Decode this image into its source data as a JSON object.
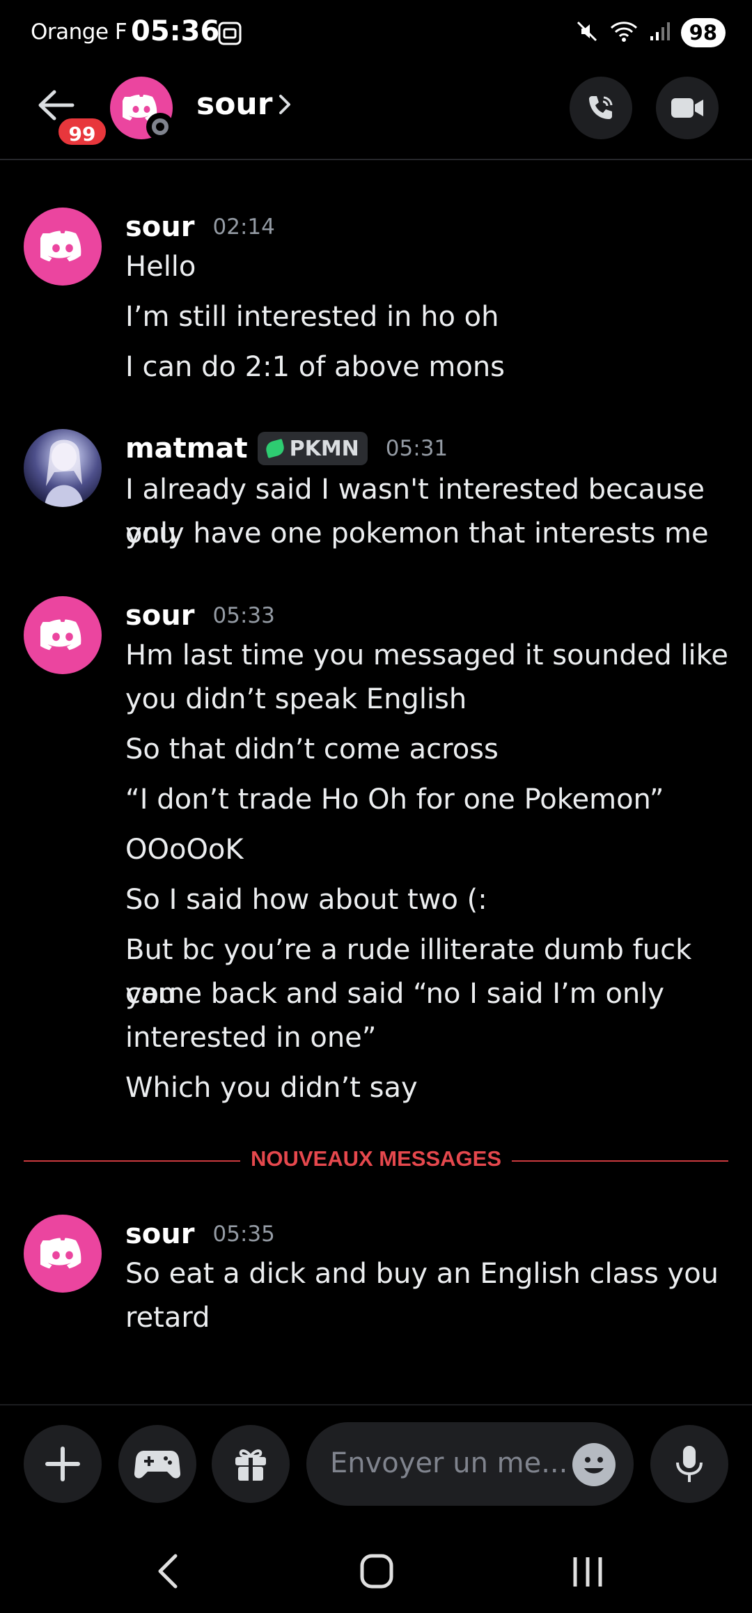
{
  "status": {
    "carrier": "Orange F",
    "time": "05:36",
    "battery": "98"
  },
  "header": {
    "back_badge": "99",
    "name": "sour"
  },
  "messages": [
    {
      "author": "sour",
      "time": "02:14",
      "lines": [
        "Hello",
        "I’m still interested in ho oh",
        "I can do 2:1 of above mons"
      ]
    },
    {
      "author": "matmat",
      "tag": "PKMN",
      "time": "05:31",
      "lines": [
        "I already said I wasn't interested because you",
        "only have one pokemon that interests me"
      ]
    },
    {
      "author": "sour",
      "time": "05:33",
      "lines": [
        "Hm last time you messaged it sounded like",
        "you didn’t speak English",
        "So that didn’t come across",
        "“I don’t trade Ho Oh for one Pokemon”",
        "OOoOoK",
        "So I said how about two (:",
        "But bc you’re a rude illiterate dumb fuck you",
        "came back and said “no I said I’m only",
        "interested in one”",
        "Which you didn’t say"
      ]
    },
    {
      "author": "sour",
      "time": "05:35",
      "lines": [
        "So eat a dick and buy an English class you",
        "retard"
      ]
    }
  ],
  "divider_label": "NOUVEAUX MESSAGES",
  "composer": {
    "placeholder": "Envoyer un me..."
  },
  "icons": {
    "status": [
      "screenshot-icon",
      "mute-icon",
      "wifi-icon",
      "signal-icon"
    ],
    "header": [
      "back-arrow-icon",
      "discord-logo-icon",
      "chevron-right-icon",
      "voice-call-icon",
      "video-call-icon"
    ],
    "composer": [
      "plus-icon",
      "gamepad-icon",
      "gift-icon",
      "emoji-icon",
      "microphone-icon"
    ],
    "navigation": [
      "nav-back-icon",
      "nav-home-icon",
      "nav-recents-icon"
    ]
  },
  "colors": {
    "accent": "#eb459f",
    "new_messages": "#e5484d",
    "background": "#000000"
  }
}
